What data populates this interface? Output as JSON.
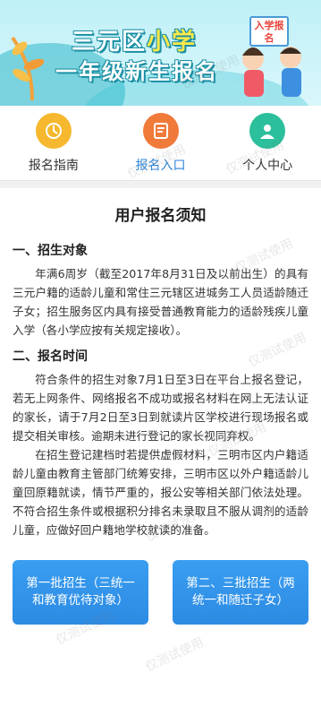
{
  "banner": {
    "title_line1_a": "三元区",
    "title_line1_b": "小学",
    "title_line2": "一年级新生报名",
    "sign_text": "入学报名"
  },
  "nav": {
    "items": [
      {
        "label": "报名指南",
        "color": "#f5b82e",
        "icon": "guide-icon"
      },
      {
        "label": "报名入口",
        "color": "#f07a3a",
        "icon": "form-icon",
        "active": true
      },
      {
        "label": "个人中心",
        "color": "#2bbf9b",
        "icon": "user-icon"
      }
    ]
  },
  "notice": {
    "title": "用户报名须知",
    "section1_title": "一、招生对象",
    "section1_text": "年满6周岁（截至2017年8月31日及以前出生）的具有三元户籍的适龄儿童和常住三元辖区进城务工人员适龄随迁子女；招生服务区内具有接受普通教育能力的适龄残疾儿童入学（各小学应按有关规定接收）。",
    "section2_title": "二、报名时间",
    "section2_text1": "符合条件的招生对象7月1日至3日在平台上报名登记，若无上网条件、网络报名不成功或报名材料在网上无法认证的家长，请于7月2日至3日到就读片区学校进行现场报名或提交相关审核。逾期未进行登记的家长视同弃权。",
    "section2_text2": "在招生登记建档时若提供虚假材料，三明市区内户籍适龄儿童由教育主管部门统筹安排，三明市区以外户籍适龄儿童回原籍就读，情节严重的，报公安等相关部门依法处理。不符合招生条件或根据积分排名未录取且不服从调剂的适龄儿童，应做好回户籍地学校就读的准备。"
  },
  "buttons": {
    "batch1": "第一批招生（三统一和教育优待对象）",
    "batch23": "第二、三批招生（两统一和随迁子女）"
  },
  "watermark_text": "仅测试使用",
  "colors": {
    "accent": "#2f86d8",
    "button": "#3a9ef0"
  }
}
